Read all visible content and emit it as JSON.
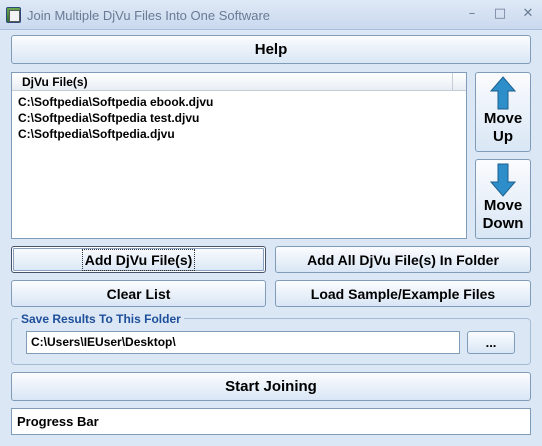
{
  "window": {
    "title": "Join Multiple DjVu Files Into One Software",
    "minimize": "–",
    "maximize": "□",
    "close": "✕"
  },
  "buttons": {
    "help": "Help",
    "add_files": "Add DjVu File(s)",
    "add_folder": "Add All DjVu File(s) In Folder",
    "clear_list": "Clear List",
    "load_sample": "Load Sample/Example Files",
    "move_up_line1": "Move",
    "move_up_line2": "Up",
    "move_down_line1": "Move",
    "move_down_line2": "Down",
    "browse": "...",
    "start": "Start Joining"
  },
  "file_list": {
    "column_header": "DjVu File(s)",
    "items": [
      "C:\\Softpedia\\Softpedia ebook.djvu",
      "C:\\Softpedia\\Softpedia test.djvu",
      "C:\\Softpedia\\Softpedia.djvu"
    ]
  },
  "output": {
    "group_label": "Save Results To This Folder",
    "folder_value": "C:\\Users\\IEUser\\Desktop\\"
  },
  "progress": {
    "label": "Progress Bar"
  },
  "colors": {
    "background": "#dce7f5",
    "arrow": "#2e8ec9",
    "group_label": "#1d4f9a"
  }
}
